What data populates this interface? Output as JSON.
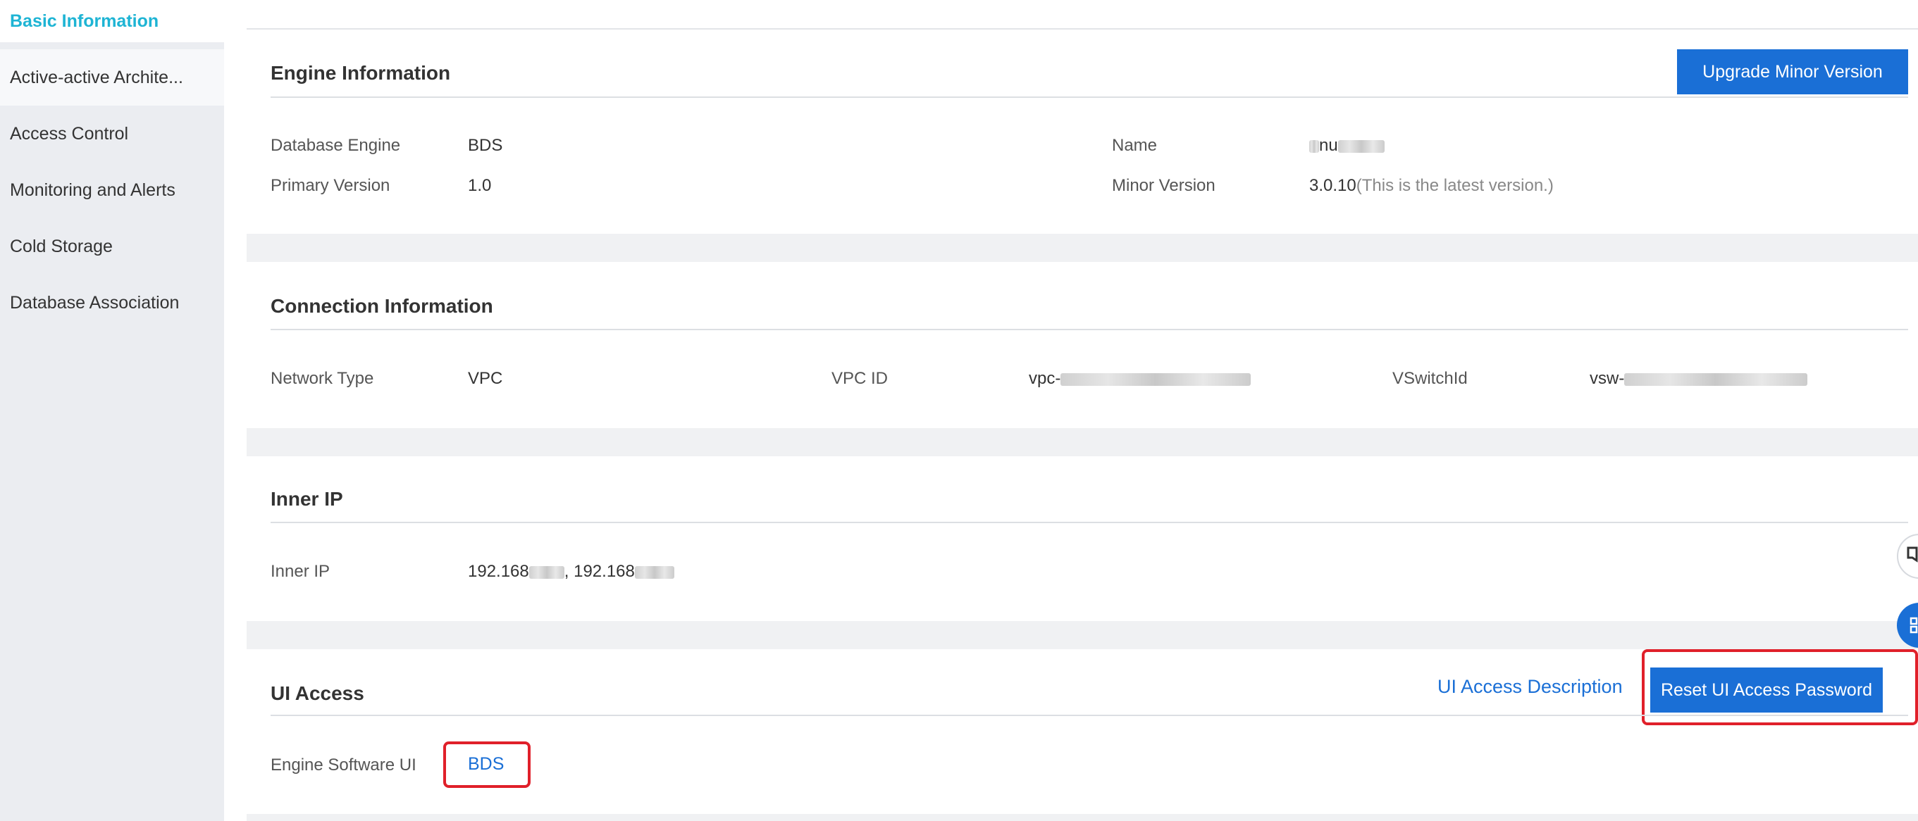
{
  "sidebar": {
    "items": [
      {
        "label": "Basic Information"
      },
      {
        "label": "Active-active Archite..."
      },
      {
        "label": "Access Control"
      },
      {
        "label": "Monitoring and Alerts"
      },
      {
        "label": "Cold Storage"
      },
      {
        "label": "Database Association"
      }
    ]
  },
  "engine_info": {
    "title": "Engine Information",
    "upgrade_button": "Upgrade Minor Version",
    "database_engine_label": "Database Engine",
    "database_engine_value": "BDS",
    "primary_version_label": "Primary Version",
    "primary_version_value": "1.0",
    "name_label": "Name",
    "name_value": "nu",
    "minor_version_label": "Minor Version",
    "minor_version_value": "3.0.10",
    "minor_version_note": "(This is the latest version.)"
  },
  "connection_info": {
    "title": "Connection Information",
    "network_type_label": "Network Type",
    "network_type_value": "VPC",
    "vpc_id_label": "VPC ID",
    "vpc_id_value": "vpc-",
    "vswitch_label": "VSwitchId",
    "vswitch_value": "vsw-"
  },
  "inner_ip": {
    "title": "Inner IP",
    "label": "Inner IP",
    "value_1": "192.168",
    "separator": ", ",
    "value_2": "192.168"
  },
  "ui_access": {
    "title": "UI Access",
    "description_link": "UI Access Description",
    "reset_button": "Reset UI Access Password",
    "engine_ui_label": "Engine Software UI",
    "engine_ui_link": "BDS"
  },
  "colors": {
    "accent": "#1eb4d4",
    "primary": "#1a6fd6",
    "highlight": "#e0202a"
  },
  "icons": [
    "feedback-icon",
    "grid-app-icon"
  ]
}
